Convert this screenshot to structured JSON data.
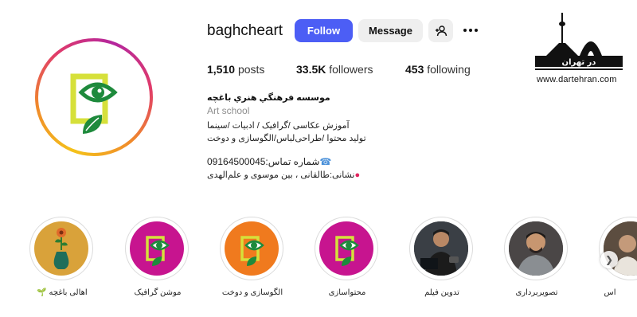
{
  "profile": {
    "username": "baghcheart",
    "follow_label": "Follow",
    "message_label": "Message",
    "posts_count": "1,510",
    "posts_label": "posts",
    "followers_count": "33.5K",
    "followers_label": "followers",
    "following_count": "453",
    "following_label": "following"
  },
  "bio": {
    "name": "موسسه فرهنگي هنري باغچه",
    "category": "Art school",
    "line1": "آموزش عکاسی /گرافیک / ادبیات /سینما",
    "line2": "تولید محتوا /طراحی‌لباس/الگوسازی و دوخت",
    "phone": "09164500045:شماره تماس",
    "address": "نشانی:طالقانی ، بین موسوی و علم‌الهدی"
  },
  "watermark": {
    "logo_text": "در تهران",
    "url": "www.dartehran.com"
  },
  "highlights": [
    {
      "label": "اهالی باغچه 🌱"
    },
    {
      "label": "موشن گرافیک"
    },
    {
      "label": "الگوسازی و دوخت"
    },
    {
      "label": "محتواسازی"
    },
    {
      "label": "تدوین فیلم"
    },
    {
      "label": "تصویربرداری"
    },
    {
      "label": "اس"
    }
  ],
  "colors": {
    "follow_button": "#4c5ef5",
    "secondary_button": "#efefef",
    "brand_green": "#1e8a3c",
    "brand_yellow": "#d6e03a",
    "highlight_magenta": "#c7148f",
    "highlight_orange": "#f07a1e"
  }
}
